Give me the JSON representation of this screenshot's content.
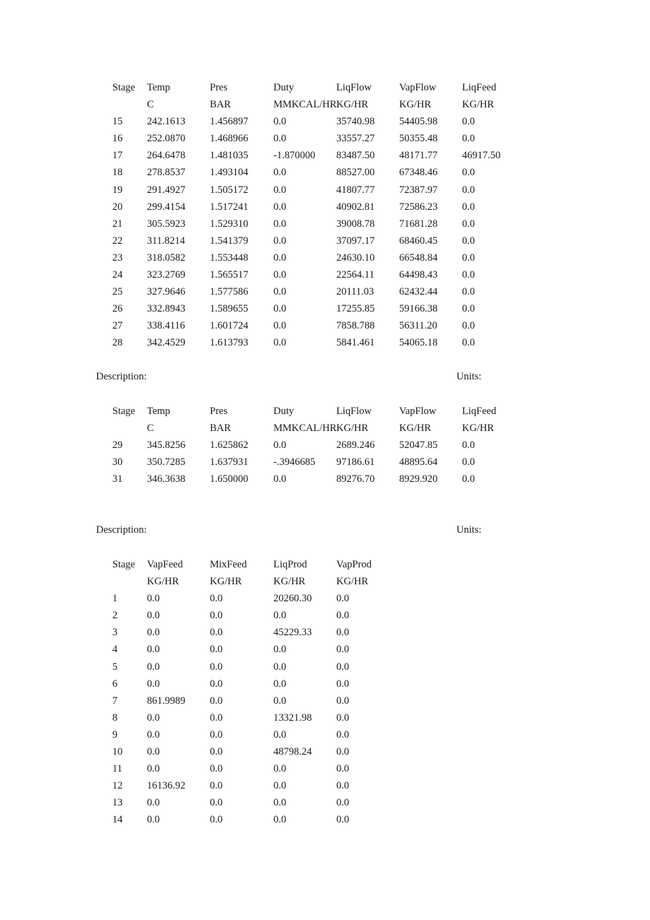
{
  "table1": {
    "headers": [
      "Stage",
      "Temp",
      "Pres",
      "Duty",
      "LiqFlow",
      "VapFlow",
      "LiqFeed"
    ],
    "units": [
      "",
      "C",
      "BAR",
      "MMKCAL/HR",
      "KG/HR",
      "KG/HR",
      "KG/HR"
    ],
    "rows": [
      [
        "15",
        "242.1613",
        "1.456897",
        "0.0",
        "35740.98",
        "54405.98",
        "0.0"
      ],
      [
        "16",
        "252.0870",
        "1.468966",
        "0.0",
        "33557.27",
        "50355.48",
        "0.0"
      ],
      [
        "17",
        "264.6478",
        "1.481035",
        "-1.870000",
        "83487.50",
        "48171.77",
        "46917.50"
      ],
      [
        "18",
        "278.8537",
        "1.493104",
        "0.0",
        "88527.00",
        "67348.46",
        "0.0"
      ],
      [
        "19",
        "291.4927",
        "1.505172",
        "0.0",
        "41807.77",
        "72387.97",
        "0.0"
      ],
      [
        "20",
        "299.4154",
        "1.517241",
        "0.0",
        "40902.81",
        "72586.23",
        "0.0"
      ],
      [
        "21",
        "305.5923",
        "1.529310",
        "0.0",
        "39008.78",
        "71681.28",
        "0.0"
      ],
      [
        "22",
        "311.8214",
        "1.541379",
        "0.0",
        "37097.17",
        "68460.45",
        "0.0"
      ],
      [
        "23",
        "318.0582",
        "1.553448",
        "0.0",
        "24630.10",
        "66548.84",
        "0.0"
      ],
      [
        "24",
        "323.2769",
        "1.565517",
        "0.0",
        "22564.11",
        "64498.43",
        "0.0"
      ],
      [
        "25",
        "327.9646",
        "1.577586",
        "0.0",
        "20111.03",
        "62432.44",
        "0.0"
      ],
      [
        "26",
        "332.8943",
        "1.589655",
        "0.0",
        "17255.85",
        "59166.38",
        "0.0"
      ],
      [
        "27",
        "338.4116",
        "1.601724",
        "0.0",
        "7858.788",
        "56311.20",
        "0.0"
      ],
      [
        "28",
        "342.4529",
        "1.613793",
        "0.0",
        "5841.461",
        "54065.18",
        "0.0"
      ]
    ]
  },
  "section2": {
    "description_label": "Description:",
    "units_label": "Units:"
  },
  "table2": {
    "headers": [
      "Stage",
      "Temp",
      "Pres",
      "Duty",
      "LiqFlow",
      "VapFlow",
      "LiqFeed"
    ],
    "units": [
      "",
      "C",
      "BAR",
      "MMKCAL/HR",
      "KG/HR",
      "KG/HR",
      "KG/HR"
    ],
    "rows": [
      [
        "29",
        "345.8256",
        "1.625862",
        "0.0",
        "2689.246",
        "52047.85",
        "0.0"
      ],
      [
        "30",
        "350.7285",
        "1.637931",
        "-.3946685",
        "97186.61",
        "48895.64",
        "0.0"
      ],
      [
        "31",
        "346.3638",
        "1.650000",
        "0.0",
        "89276.70",
        "8929.920",
        "0.0"
      ]
    ]
  },
  "section3": {
    "description_label": "Description:",
    "units_label": "Units:"
  },
  "table3": {
    "headers": [
      "Stage",
      "VapFeed",
      "MixFeed",
      "LiqProd",
      "VapProd"
    ],
    "units": [
      "",
      "KG/HR",
      "KG/HR",
      "KG/HR",
      "KG/HR"
    ],
    "rows": [
      [
        "1",
        "0.0",
        "0.0",
        "20260.30",
        "0.0"
      ],
      [
        "2",
        "0.0",
        "0.0",
        "0.0",
        "0.0"
      ],
      [
        "3",
        "0.0",
        "0.0",
        "45229.33",
        "0.0"
      ],
      [
        "4",
        "0.0",
        "0.0",
        "0.0",
        "0.0"
      ],
      [
        "5",
        "0.0",
        "0.0",
        "0.0",
        "0.0"
      ],
      [
        "6",
        "0.0",
        "0.0",
        "0.0",
        "0.0"
      ],
      [
        "7",
        "861.9989",
        "0.0",
        "0.0",
        "0.0"
      ],
      [
        "8",
        "0.0",
        "0.0",
        "13321.98",
        "0.0"
      ],
      [
        "9",
        "0.0",
        "0.0",
        "0.0",
        "0.0"
      ],
      [
        "10",
        "0.0",
        "0.0",
        "48798.24",
        "0.0"
      ],
      [
        "11",
        "0.0",
        "0.0",
        "0.0",
        "0.0"
      ],
      [
        "12",
        "16136.92",
        "0.0",
        "0.0",
        "0.0"
      ],
      [
        "13",
        "0.0",
        "0.0",
        "0.0",
        "0.0"
      ],
      [
        "14",
        "0.0",
        "0.0",
        "0.0",
        "0.0"
      ]
    ]
  }
}
